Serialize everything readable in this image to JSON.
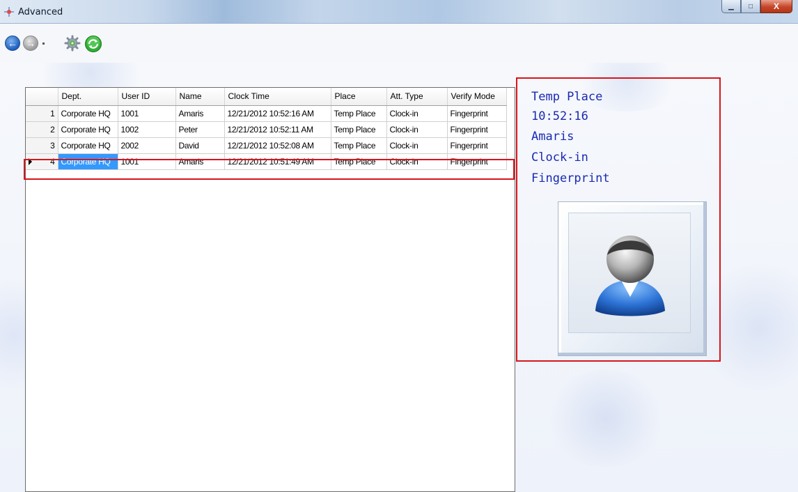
{
  "window": {
    "title": "Advanced",
    "controls": {
      "minimize": "▁",
      "maximize": "□",
      "close": "X"
    }
  },
  "toolbar": {
    "items": [
      "back-icon",
      "forward-icon",
      "settings-gear-icon",
      "refresh-icon"
    ]
  },
  "grid": {
    "columns": [
      "Dept.",
      "User ID",
      "Name",
      "Clock Time",
      "Place",
      "Att. Type",
      "Verify Mode"
    ],
    "rows": [
      {
        "num": "1",
        "dept": "Corporate HQ",
        "user_id": "1001",
        "name": "Amaris",
        "clock_time": "12/21/2012 10:52:16 AM",
        "place": "Temp Place",
        "att_type": "Clock-in",
        "verify_mode": "Fingerprint"
      },
      {
        "num": "2",
        "dept": "Corporate HQ",
        "user_id": "1002",
        "name": "Peter",
        "clock_time": "12/21/2012 10:52:11 AM",
        "place": "Temp Place",
        "att_type": "Clock-in",
        "verify_mode": "Fingerprint"
      },
      {
        "num": "3",
        "dept": "Corporate HQ",
        "user_id": "2002",
        "name": "David",
        "clock_time": "12/21/2012 10:52:08 AM",
        "place": "Temp Place",
        "att_type": "Clock-in",
        "verify_mode": "Fingerprint"
      },
      {
        "num": "4",
        "dept": "Corporate HQ",
        "user_id": "1001",
        "name": "Amaris",
        "clock_time": "12/21/2012 10:51:49 AM",
        "place": "Temp Place",
        "att_type": "Clock-in",
        "verify_mode": "Fingerprint"
      }
    ],
    "selected_row": 4
  },
  "info": {
    "place": "Temp Place",
    "time": "10:52:16",
    "name": "Amaris",
    "att_type": "Clock-in",
    "verify_mode": "Fingerprint",
    "photo_icon": "user-avatar-icon"
  },
  "colors": {
    "highlight": "#d8141c",
    "info_text": "#1a2ab0",
    "selection": "#3399ff"
  }
}
